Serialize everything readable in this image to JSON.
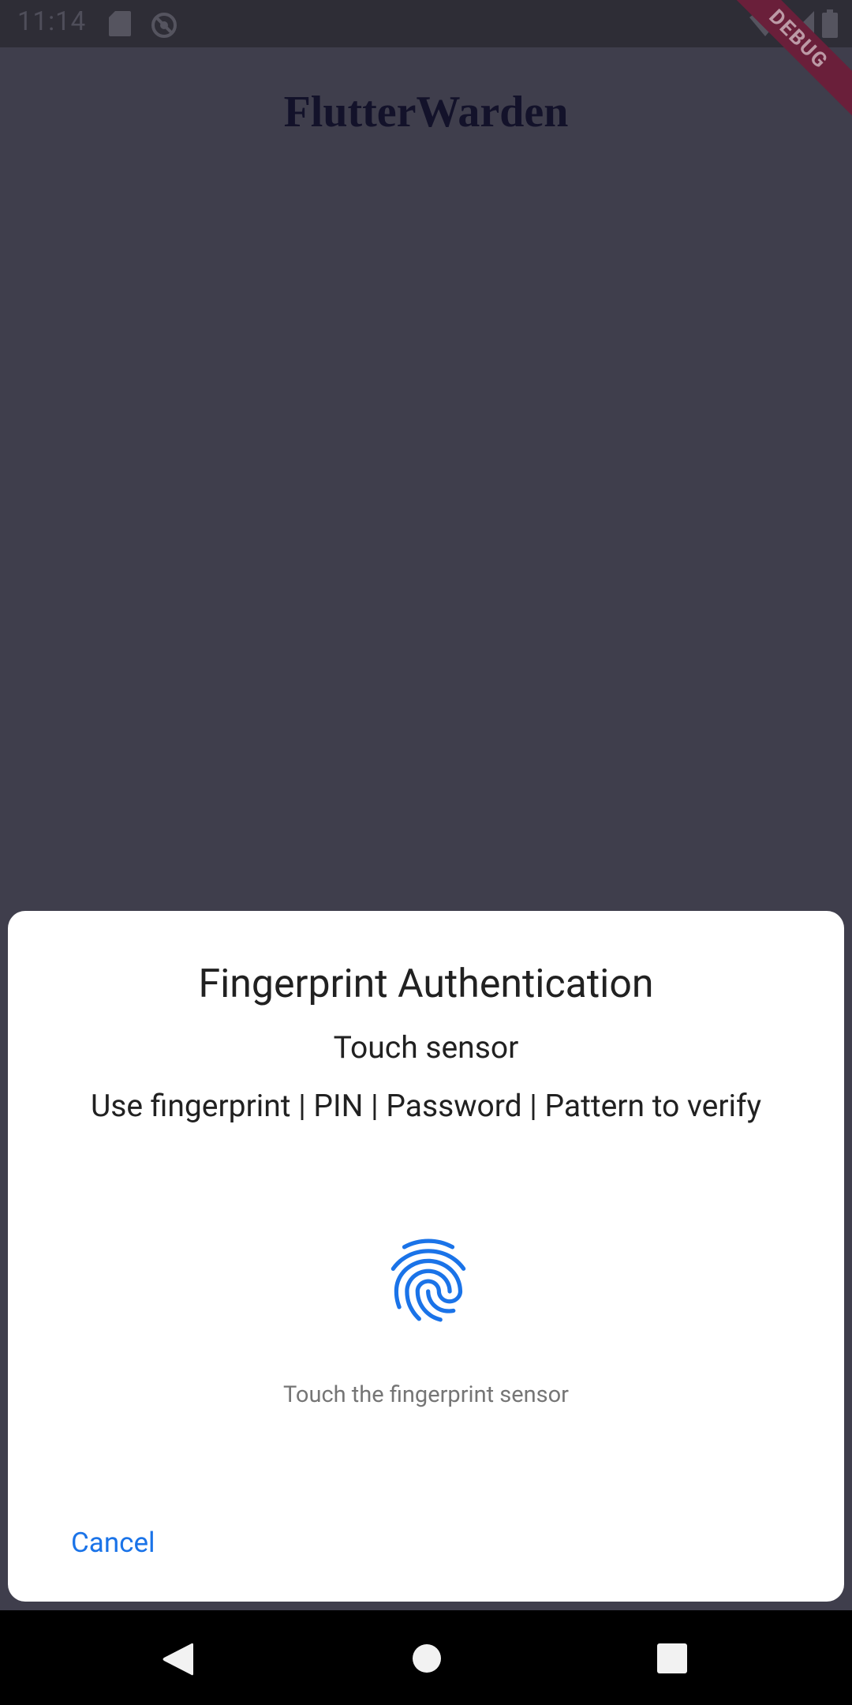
{
  "status_bar": {
    "time": "11:14",
    "icons": [
      "sd-card-icon",
      "sync-icon",
      "wifi-icon",
      "signal-icon",
      "battery-icon"
    ]
  },
  "debug_banner": "DEBUG",
  "app": {
    "title": "FlutterWarden"
  },
  "dialog": {
    "title": "Fingerprint Authentication",
    "subtitle": "Touch sensor",
    "description": "Use fingerprint | PIN | Password | Pattern to verify",
    "icon": "fingerprint-icon",
    "hint": "Touch the fingerprint sensor",
    "cancel_label": "Cancel"
  },
  "nav_bar": {
    "buttons": [
      "back-icon",
      "home-icon",
      "recents-icon"
    ]
  },
  "colors": {
    "background": "#3f3e4c",
    "status_bar": "#2e2d36",
    "accent": "#1a73e8",
    "title": "#13122a",
    "ribbon": "#6a1f3a"
  }
}
